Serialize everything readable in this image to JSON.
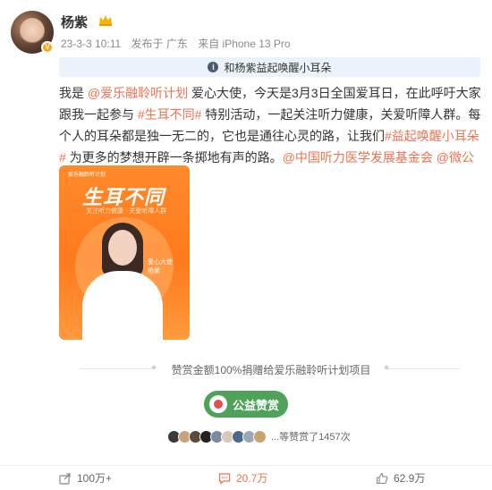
{
  "post": {
    "author": "杨紫",
    "verified_badge": "V",
    "meta": {
      "time": "23-3-3 10:11",
      "location": "发布于 广东",
      "device": "来自 iPhone 13 Pro"
    },
    "topic_banner": "和杨紫益起唤醒小耳朵",
    "content": {
      "t1": "我是 ",
      "mention1": "@爱乐融聆听计划",
      "t2": " 爱心大使，今天是3月3日全国爱耳日，在此呼吁大家跟我一起参与 ",
      "tag1": "#生耳不同#",
      "t3": " 特别活动，一起关注听力健康，关爱听障人群。每个人的耳朵都是独一无二的，它也是通往心灵的路，让我们",
      "tag2": "#益起唤醒小耳朵#",
      "t4": " 为更多的梦想开辟一条掷地有声的路。",
      "mention2": "@中国听力医学发展基金会",
      "t5": " ",
      "mention3": "@微公益"
    },
    "poster": {
      "logo": "爱乐融聆听计划",
      "title": "生耳不同",
      "subtitle": "关注听力健康 · 关爱听障人群",
      "tag": "爱心大使 杨紫"
    },
    "reward_text": "赞赏金额100%捐赠给爱乐融聆听计划项目",
    "charity_button": "公益赞赏",
    "supporters_text": "...等赞赏了1457次",
    "supporter_colors": [
      "#3a3a3a",
      "#c9a27e",
      "#5a4a3a",
      "#222222",
      "#7a8aa0",
      "#d8c8b8",
      "#4a6a8a",
      "#9aa8b8",
      "#caa070"
    ],
    "actions": {
      "share": "100万+",
      "comment": "20.7万",
      "like": "62.9万"
    },
    "colors": {
      "link": "#eb7350",
      "charity_green": "#4ea25a",
      "banner_bg": "#eaf2fb"
    }
  }
}
